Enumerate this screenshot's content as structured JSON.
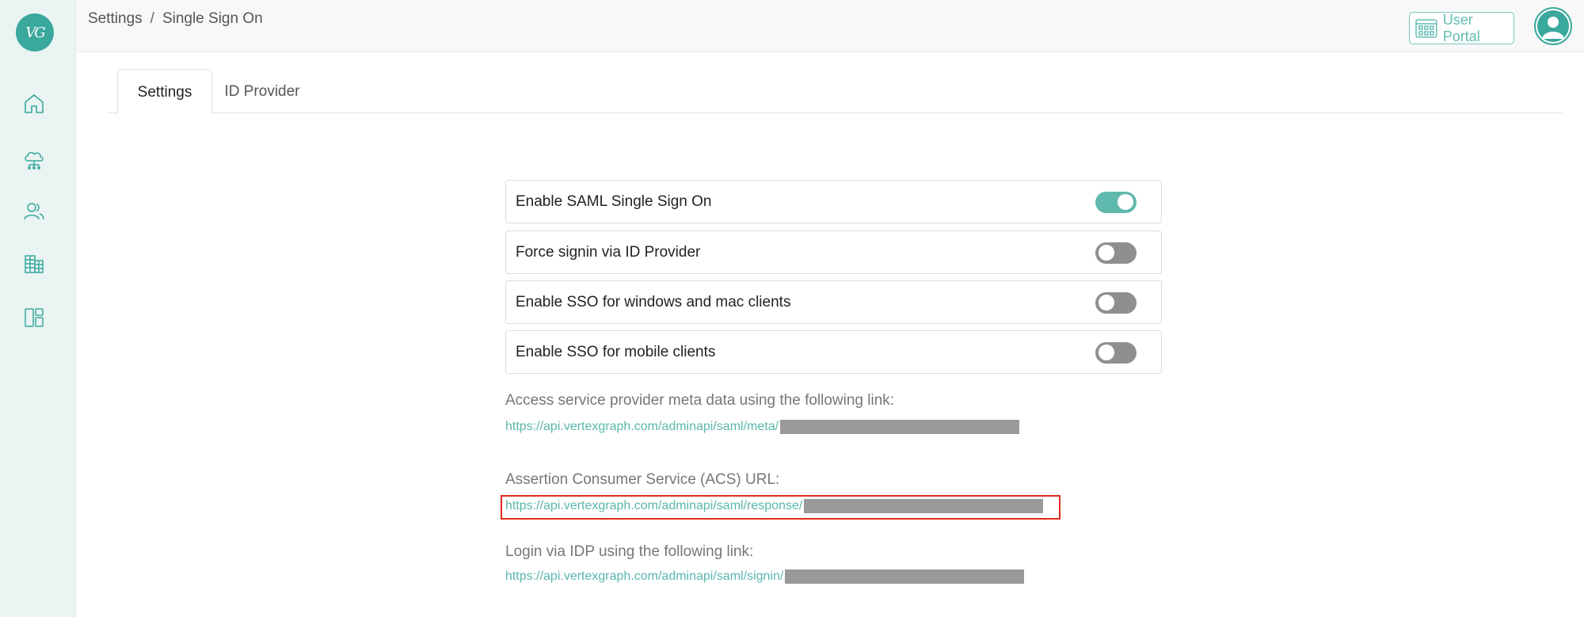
{
  "app": {
    "logo_text": "VG",
    "brand_color": "#3aa89c",
    "accent_color": "#5fb9ad"
  },
  "sidebar": {
    "items": [
      {
        "icon": "home-icon"
      },
      {
        "icon": "cloud-network-icon"
      },
      {
        "icon": "users-icon"
      },
      {
        "icon": "buildings-icon"
      },
      {
        "icon": "layout-icon"
      }
    ]
  },
  "header": {
    "breadcrumb": [
      "Settings",
      "Single Sign On"
    ],
    "breadcrumb_separator": "/",
    "user_portal_label": "User Portal"
  },
  "tabs": [
    {
      "label": "Settings",
      "active": true
    },
    {
      "label": "ID Provider",
      "active": false
    }
  ],
  "settings": [
    {
      "label": "Enable SAML Single Sign On",
      "enabled": true
    },
    {
      "label": "Force signin via ID Provider",
      "enabled": false
    },
    {
      "label": "Enable SSO for windows and mac clients",
      "enabled": false
    },
    {
      "label": "Enable SSO for mobile clients",
      "enabled": false
    }
  ],
  "links": {
    "meta_label": "Access service provider meta data using the following link:",
    "meta_url": "https://api.vertexgraph.com/adminapi/saml/meta/",
    "acs_label": "Assertion Consumer Service (ACS) URL:",
    "acs_url": "https://api.vertexgraph.com/adminapi/saml/response/",
    "login_label": "Login via IDP using the following link:",
    "login_url": "https://api.vertexgraph.com/adminapi/saml/signin/"
  }
}
